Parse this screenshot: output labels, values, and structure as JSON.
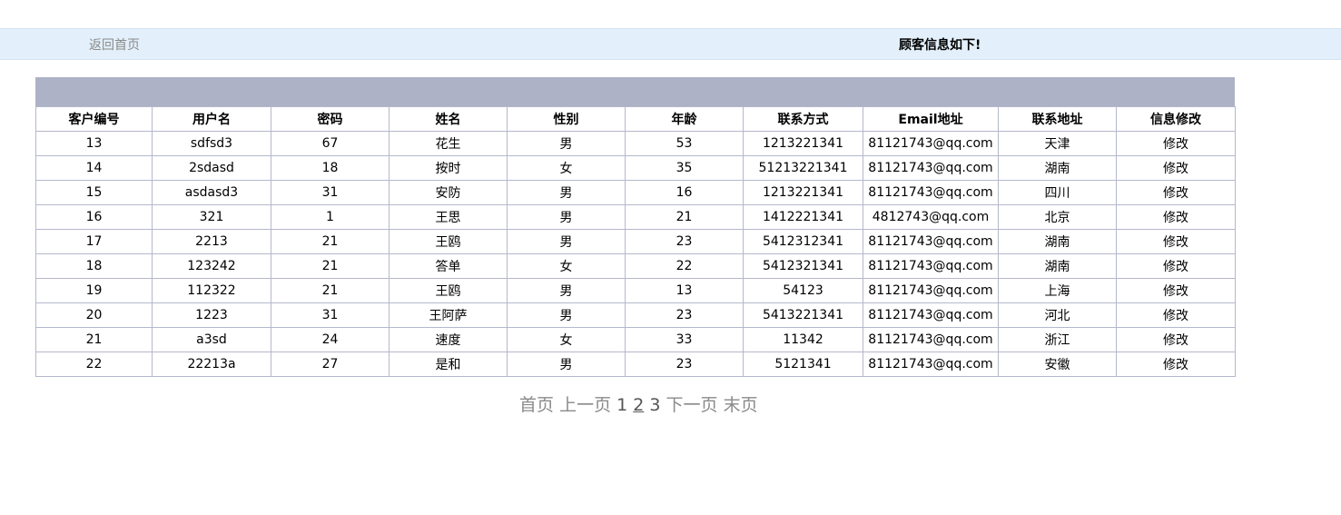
{
  "nav": {
    "back_label": "返回首页",
    "heading": "顾客信息如下!"
  },
  "table": {
    "columns": [
      "客户编号",
      "用户名",
      "密码",
      "姓名",
      "性别",
      "年龄",
      "联系方式",
      "Email地址",
      "联系地址",
      "信息修改"
    ],
    "rows": [
      [
        "13",
        "sdfsd3",
        "67",
        "花生",
        "男",
        "53",
        "1213221341",
        "81121743@qq.com",
        "天津",
        "修改"
      ],
      [
        "14",
        "2sdasd",
        "18",
        "按时",
        "女",
        "35",
        "51213221341",
        "81121743@qq.com",
        "湖南",
        "修改"
      ],
      [
        "15",
        "asdasd3",
        "31",
        "安防",
        "男",
        "16",
        "1213221341",
        "81121743@qq.com",
        "四川",
        "修改"
      ],
      [
        "16",
        "321",
        "1",
        "王思",
        "男",
        "21",
        "1412221341",
        "4812743@qq.com",
        "北京",
        "修改"
      ],
      [
        "17",
        "2213",
        "21",
        "王鸥",
        "男",
        "23",
        "5412312341",
        "81121743@qq.com",
        "湖南",
        "修改"
      ],
      [
        "18",
        "123242",
        "21",
        "答单",
        "女",
        "22",
        "5412321341",
        "81121743@qq.com",
        "湖南",
        "修改"
      ],
      [
        "19",
        "112322",
        "21",
        "王鸥",
        "男",
        "13",
        "54123",
        "81121743@qq.com",
        "上海",
        "修改"
      ],
      [
        "20",
        "1223",
        "31",
        "王阿萨",
        "男",
        "23",
        "5413221341",
        "81121743@qq.com",
        "河北",
        "修改"
      ],
      [
        "21",
        "a3sd",
        "24",
        "速度",
        "女",
        "33",
        "11342",
        "81121743@qq.com",
        "浙江",
        "修改"
      ],
      [
        "22",
        "22213a",
        "27",
        "是和",
        "男",
        "23",
        "5121341",
        "81121743@qq.com",
        "安徽",
        "修改"
      ]
    ]
  },
  "pager": {
    "first": "首页",
    "prev": "上一页",
    "pages": [
      "1",
      "2",
      "3"
    ],
    "current_page": "2",
    "next": "下一页",
    "last": "末页"
  }
}
